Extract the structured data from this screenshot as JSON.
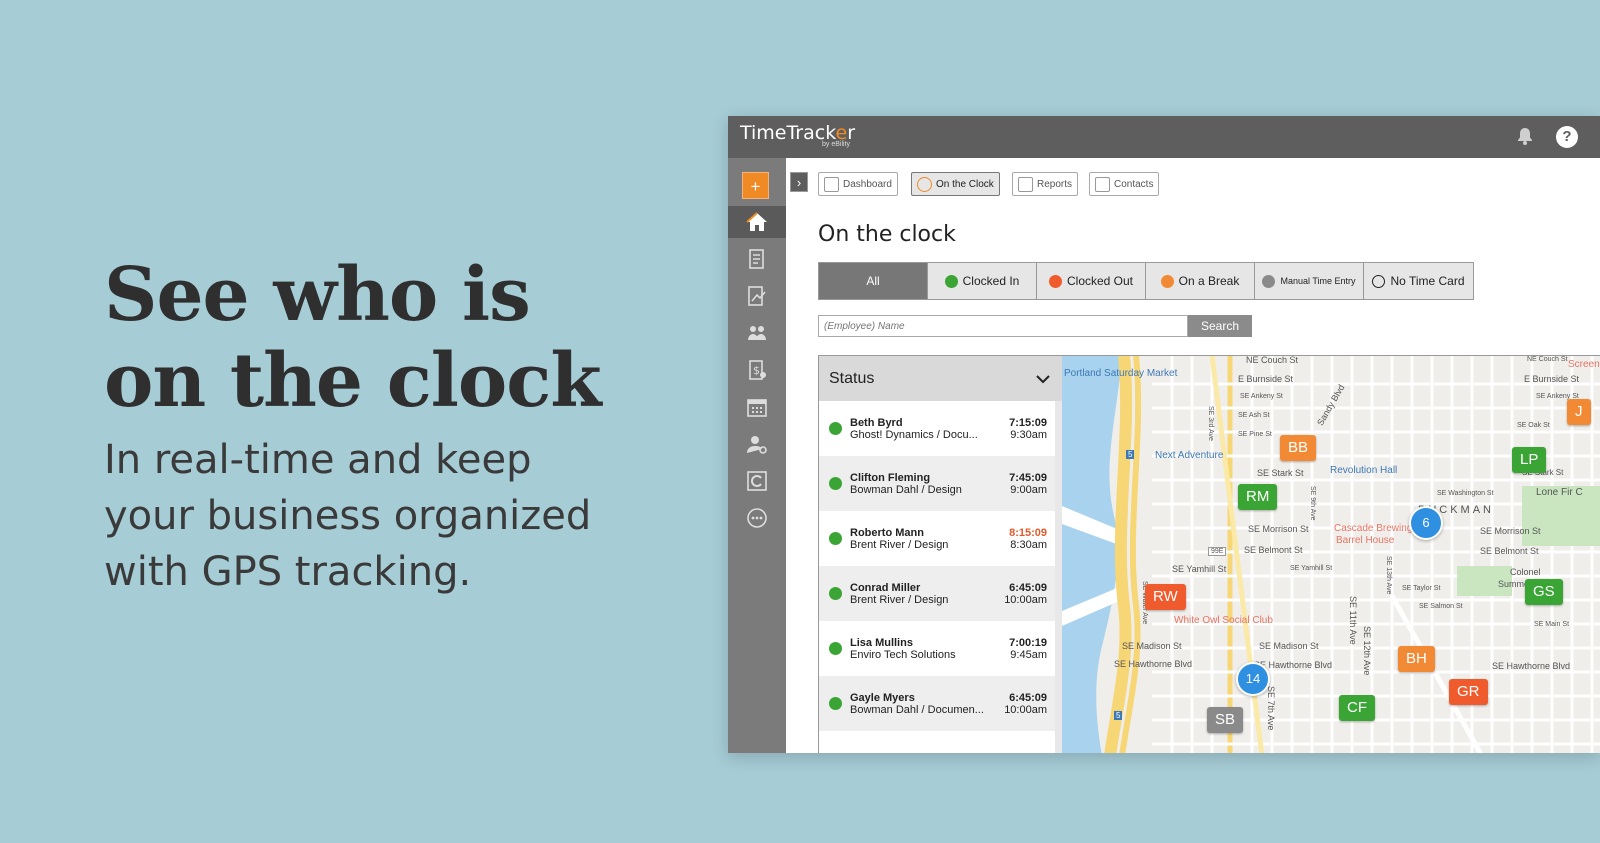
{
  "hero": {
    "headline_1": "See who is",
    "headline_2": "on the clock",
    "tagline_1": "In real-time and keep",
    "tagline_2": "your business organized",
    "tagline_3": "with GPS tracking."
  },
  "app": {
    "logo": "TimeTrack",
    "logo_o": "e",
    "logo_tail": "r",
    "logo_sub": "by eBility",
    "help_label": "?",
    "plus_label": "+",
    "expand_label": "›",
    "nav": {
      "dashboard": "Dashboard",
      "on_the_clock": "On the Clock",
      "reports": "Reports",
      "contacts": "Contacts"
    },
    "page_title": "On the clock",
    "filters": {
      "all": "All",
      "clocked_in": "Clocked In",
      "clocked_out": "Clocked Out",
      "on_break": "On a Break",
      "manual": "Manual Time Entry",
      "no_card": "No Time Card"
    },
    "search": {
      "placeholder": "(Employee) Name",
      "button": "Search"
    },
    "status_panel": {
      "title": "Status",
      "rows": [
        {
          "name": "Beth Byrd",
          "company": "Ghost! Dynamics / Docu...",
          "elapsed": "7:15:09",
          "start": "9:30am"
        },
        {
          "name": "Clifton Fleming",
          "company": "Bowman Dahl / Design",
          "elapsed": "7:45:09",
          "start": "9:00am"
        },
        {
          "name": "Roberto Mann",
          "company": "Brent River / Design",
          "elapsed": "8:15:09",
          "start": "8:30am"
        },
        {
          "name": "Conrad Miller",
          "company": "Brent River / Design",
          "elapsed": "6:45:09",
          "start": "10:00am"
        },
        {
          "name": "Lisa Mullins",
          "company": "Enviro Tech Solutions",
          "elapsed": "7:00:19",
          "start": "9:45am"
        },
        {
          "name": "Gayle Myers",
          "company": "Bowman Dahl / Documen...",
          "elapsed": "6:45:09",
          "start": "10:00am"
        }
      ]
    },
    "map": {
      "labels": {
        "portland": "Portland Saturday Market",
        "couch": "NE Couch St",
        "couch2": "NE Couch St",
        "burnside": "E Burnside St",
        "burnside2": "E Burnside St",
        "screen": "Screen Door",
        "ankeny": "SE Ankeny St",
        "ankeny2": "SE Ankeny St",
        "ash": "SE Ash St",
        "pine": "SE Pine St",
        "oak": "SE Oak St",
        "next_adv": "Next Adventure",
        "revolution": "Revolution Hall",
        "stark": "SE Stark St",
        "stark2": "SE Stark St",
        "washington": "SE Washington St",
        "buckman": "BUCKMAN",
        "morrison": "SE Morrison St",
        "morrison2": "SE Morrison St",
        "cascade": "Cascade Brewing",
        "cascade2": "Barrel House",
        "belmont": "SE Belmont St",
        "belmont2": "SE Belmont St",
        "yamhill": "SE Yamhill St",
        "yamhill2": "SE Yamhill St",
        "taylor": "SE Taylor St",
        "colonel": "Colonel",
        "summers": "Summers Park",
        "salmon": "SE Salmon St",
        "white_owl": "White Owl Social Club",
        "madison": "SE Madison St",
        "madison2": "SE Madison St",
        "main": "SE Main St",
        "hawthorne": "SE Hawthorne Blvd",
        "hawthorne2": "SE Hawthorne Blvd",
        "hawthorne3": "SE Hawthorne Blvd",
        "lone_fir": "Lone Fir C",
        "sandy": "Sandy Blvd",
        "third": "SE 3rd Ave",
        "water": "SE Water Ave",
        "ave11": "SE 11th Ave",
        "ave12": "SE 12th Ave",
        "ave13": "SE 13th Ave",
        "ave7": "SE 7th Ave",
        "ave9": "SE 9th Ave",
        "hwy": "5",
        "hwy2": "5",
        "hwy99": "99E"
      },
      "pins": {
        "bb": "BB",
        "lp": "LP",
        "j": "J",
        "rm": "RM",
        "rw": "RW",
        "gs": "GS",
        "bh": "BH",
        "gr": "GR",
        "cf": "CF",
        "sb": "SB"
      },
      "clusters": {
        "c6": "6",
        "c14": "14"
      }
    }
  },
  "colors": {
    "background": "#a6ccd6",
    "accent": "#f08a24",
    "clocked_in": "#3aa535",
    "clocked_out": "#ef5b2c",
    "on_break": "#f28a35",
    "manual": "#8a8a8a",
    "cluster": "#2f8fe0"
  },
  "icons": [
    "bell-icon",
    "help-icon",
    "home-icon",
    "timesheet-icon",
    "reports-icon",
    "people-icon",
    "invoice-icon",
    "calendar-icon",
    "user-settings-icon",
    "c-icon",
    "more-icon",
    "chevron-down-icon"
  ]
}
